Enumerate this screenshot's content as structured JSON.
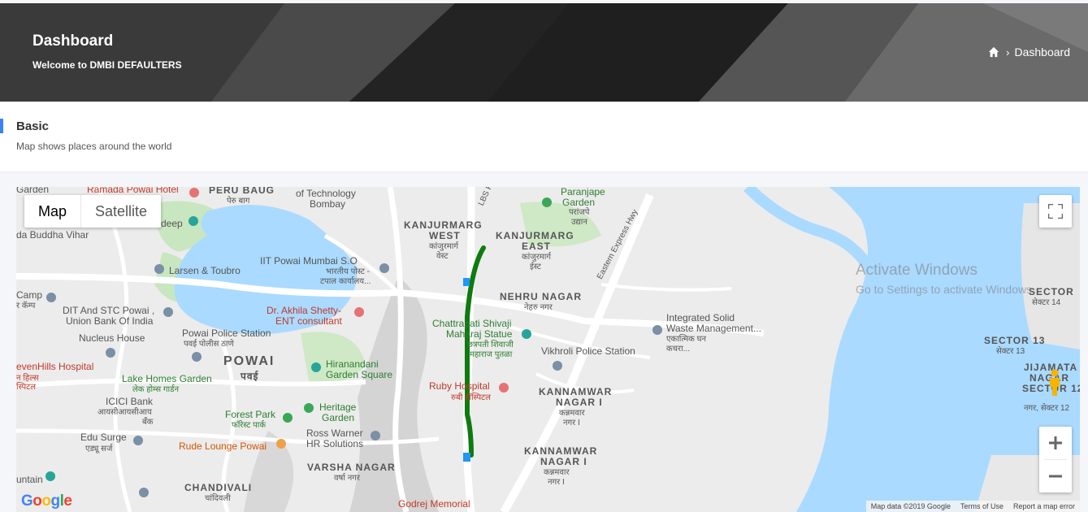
{
  "header": {
    "title": "Dashboard",
    "subtitle": "Welcome to DMBI DEFAULTERS",
    "breadcrumb": {
      "home_icon": "home-icon",
      "separator": "›",
      "current": "Dashboard"
    }
  },
  "card": {
    "title": "Basic",
    "description": "Map shows places around the world",
    "accent_color": "#3b82f6"
  },
  "map": {
    "type_buttons": {
      "map": "Map",
      "satellite": "Satellite"
    },
    "labels": {
      "garden": "Garden",
      "ramada": "Ramada Powai Hotel",
      "peru_baug": "PERU BAUG",
      "peru_baug_mr": "पेरु बाग",
      "iit_bombay": "of Technology",
      "iit_bombay2": "Bombay",
      "deep": "deep",
      "buddha_vihar": "da Buddha Vihar",
      "larsen": "Larsen & Toubro",
      "iit_post": "IIT Powai Mumbai S.O",
      "iit_post_mr": "भारतीय पोस्ट -",
      "iit_post_mr2": "टपाल कार्यालय...",
      "camp": "Camp",
      "camp_mr": "र कॅम्प",
      "dit": "DIT And STC Powai ,",
      "dit2": "Union Bank Of India",
      "akhila": "Dr. Akhila Shetty-",
      "akhila2": "ENT consultant",
      "nucleus": "Nucleus House",
      "powai_police": "Powai Police Station",
      "powai_police_mr": "पवई पोलीस ठाणे",
      "powai": "POWAI",
      "powai_mr": "पवई",
      "hiranandani": "Hiranandani",
      "hiranandani2": "Garden Square",
      "sevenhills": "evenHills Hospital",
      "sevenhills_mr": "न हिल्स",
      "sevenhills_mr2": "स्पिटल",
      "lake_homes": "Lake Homes Garden",
      "lake_homes_mr": "लेक होम्स गार्डन",
      "icici": "ICICI Bank",
      "icici_mr": "आयसीआयसीआय",
      "icici_mr2": "बँक",
      "forest_park": "Forest Park",
      "forest_park_mr": "फॉरेस्ट पार्क",
      "heritage": "Heritage",
      "heritage2": "Garden",
      "edu_surge": "Edu Surge",
      "edu_surge_mr": "एड्यू सर्ज",
      "ross": "Ross Warner",
      "ross2": "HR Solutions",
      "rude": "Rude Lounge Powai",
      "varsha": "VARSHA NAGAR",
      "varsha_mr": "वर्षा नगर",
      "untain": "untain",
      "chandivali": "CHANDIVALI",
      "chandivali_mr": "चांदिवली",
      "godrej": "Godrej Memorial",
      "kanjurmarg_w": "KANJURMARG",
      "kanjurmarg_w2": "WEST",
      "kanjurmarg_w_mr": "कांजुरमार्ग",
      "kanjurmarg_w_mr2": "वेस्ट",
      "lbs": "LBS Rd",
      "paranjape": "Paranjape",
      "paranjape2": "Garden",
      "paranjape_mr": "परांजपे",
      "paranjape_mr2": "उद्यान",
      "kanjurmarg_e": "KANJURMARG",
      "kanjurmarg_e2": "EAST",
      "kanjurmarg_e_mr": "कांजुरमार्ग",
      "kanjurmarg_e_mr2": "ईस्ट",
      "eastern_express": "Eastern Express Hwy",
      "nehru": "NEHRU NAGAR",
      "nehru_mr": "नेहरु नगर",
      "chattrapati": "Chattrapati Shivaji",
      "chattrapati2": "Maharaj Statue",
      "chattrapati_mr": "छत्रपती शिवाजी",
      "chattrapati_mr2": "महाराज पुतळा",
      "vikhroli_police": "Vikhroli Police Station",
      "ruby": "Ruby Hospital",
      "ruby_mr": "रुबी हॉस्पिटल",
      "kannamwar1": "KANNAMWAR",
      "kannamwar1b": "NAGAR I",
      "kannamwar1_mr": "कन्नमवार",
      "kannamwar1_mr2": "नगर I",
      "kannamwar2": "KANNAMWAR",
      "kannamwar2b": "NAGAR I",
      "kannamwar2_mr": "कन्नमवार",
      "kannamwar2_mr2": "नगर I",
      "integrated": "Integrated Solid",
      "integrated2": "Waste Management...",
      "integrated_mr": "एकात्मिक घन",
      "integrated_mr2": "कचरा...",
      "sector14": "SECTOR",
      "sector14b": "सेक्टर 14",
      "sector13": "SECTOR 13",
      "sector13b": "सेक्टर 13",
      "jijamata": "JIJAMATA",
      "jijamata2": "NAGAR",
      "jijamata3": "SECTOR 12",
      "jijamata4": "नगर, सेक्टर 12"
    },
    "attribution": {
      "map_data": "Map data ©2019 Google",
      "terms": "Terms of Use",
      "report": "Report a map error"
    },
    "google_logo": "Google",
    "route_color": "#107a10",
    "water_color": "#aadaff"
  },
  "watermark": {
    "line1": "Activate Windows",
    "line2": "Go to Settings to activate Windows."
  }
}
